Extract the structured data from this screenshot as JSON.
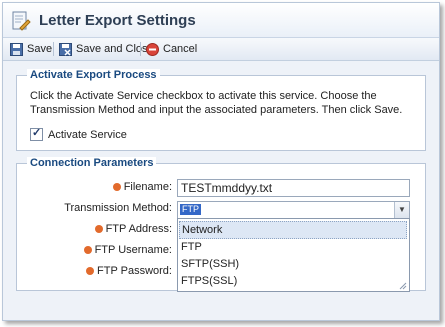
{
  "window": {
    "title": "Letter Export Settings"
  },
  "toolbar": {
    "save_label": "Save",
    "save_close_label": "Save and Close",
    "cancel_label": "Cancel"
  },
  "activate": {
    "legend": "Activate Export Process",
    "help": "Click the Activate Service checkbox to activate this service. Choose the Transmission Method and input the associated parameters. Then click Save.",
    "checkbox_label": "Activate Service",
    "checked": true
  },
  "connection": {
    "legend": "Connection Parameters",
    "filename_label": "Filename:",
    "filename_value": "TESTmmddyy.txt",
    "method_label": "Transmission Method:",
    "method_selected": "FTP",
    "ftp_address_label": "FTP Address:",
    "ftp_username_label": "FTP Username:",
    "ftp_password_label": "FTP Password:",
    "method_options": [
      "Network",
      "FTP",
      "SFTP(SSH)",
      "FTPS(SSL)"
    ]
  },
  "colors": {
    "accent": "#1a4a80",
    "required": "#e26a2c",
    "selection": "#3367c7"
  }
}
